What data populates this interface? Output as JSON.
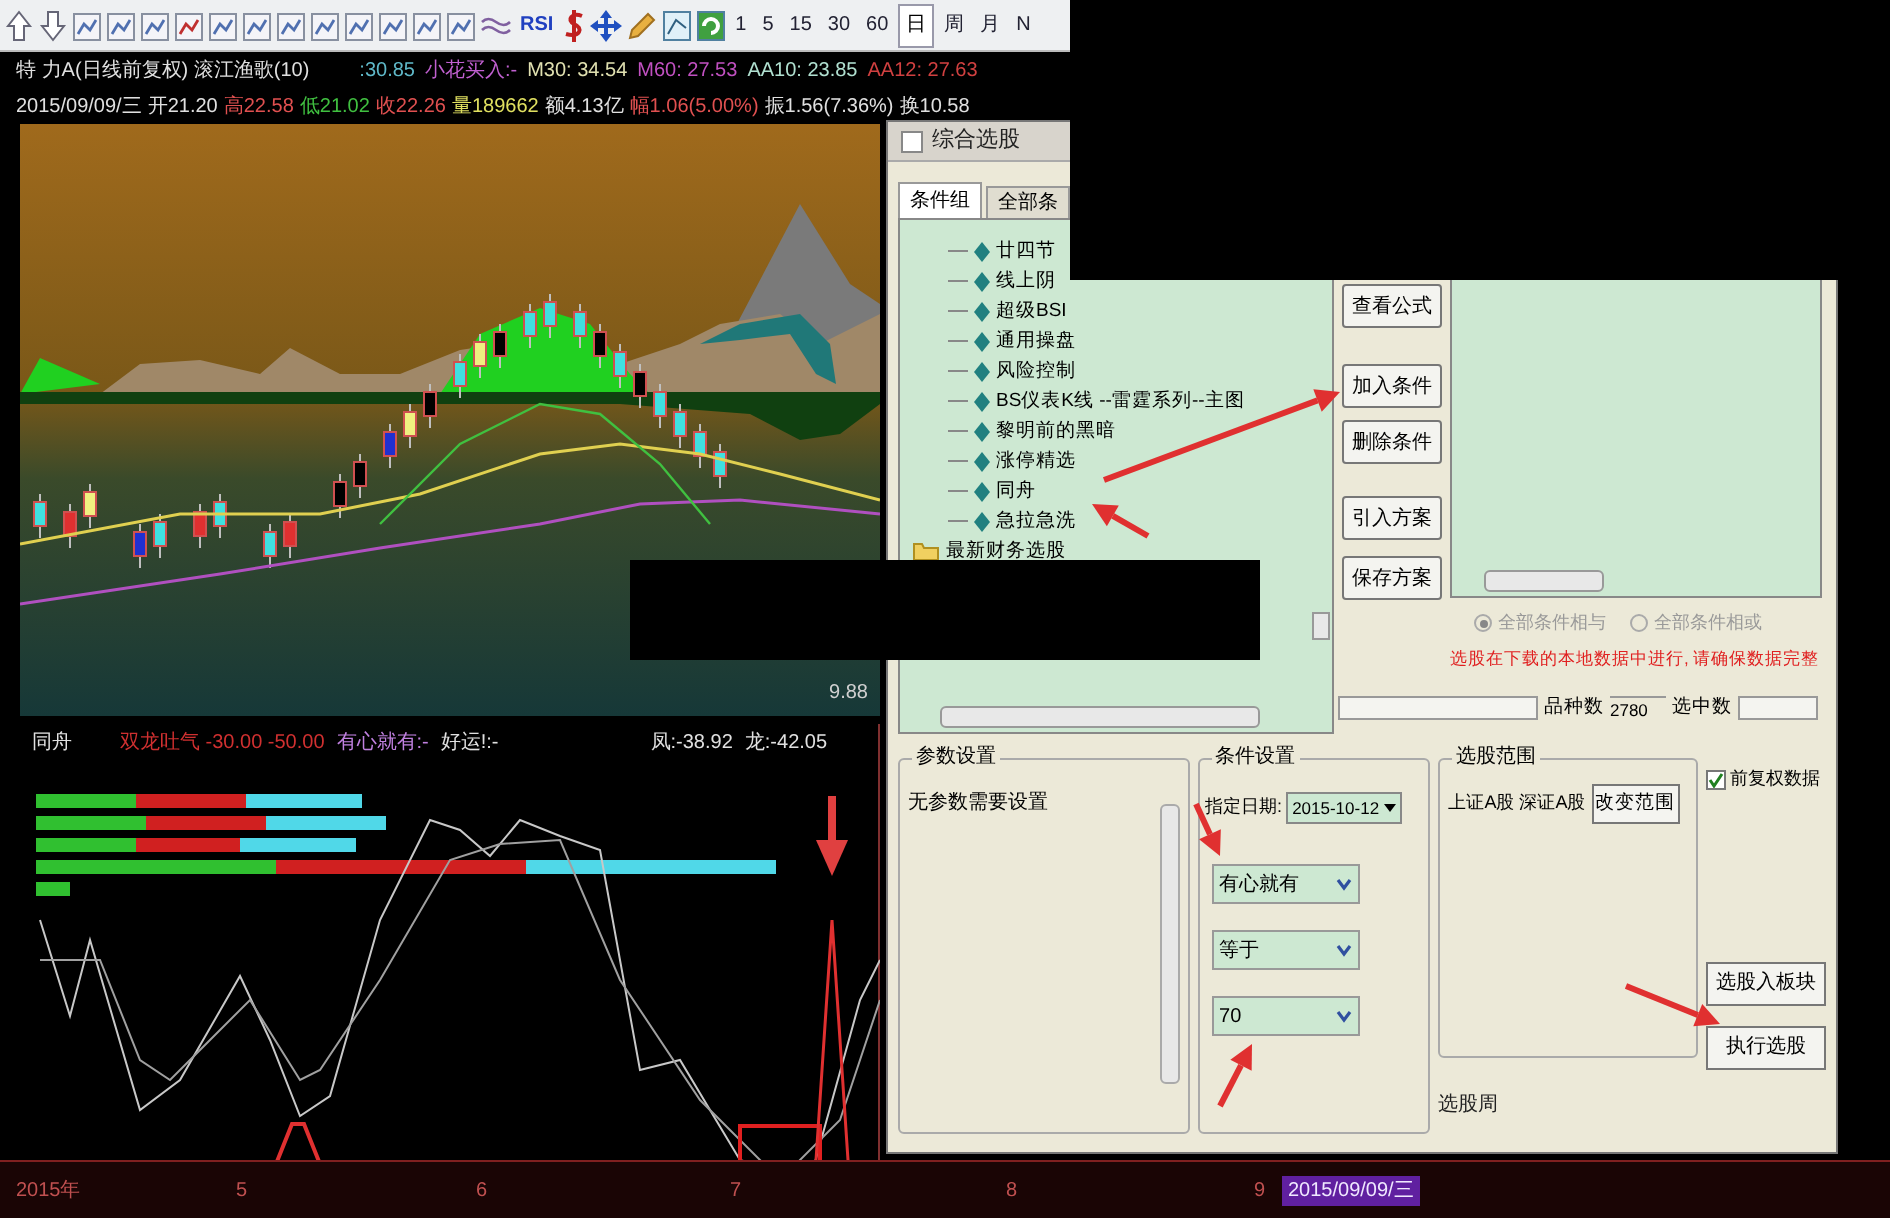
{
  "toolbar": {
    "periods": [
      {
        "label": "1",
        "selected": false
      },
      {
        "label": "5",
        "selected": false
      },
      {
        "label": "15",
        "selected": false
      },
      {
        "label": "30",
        "selected": false
      },
      {
        "label": "60",
        "selected": false
      },
      {
        "label": "日",
        "selected": true
      },
      {
        "label": "周",
        "selected": false
      },
      {
        "label": "月",
        "selected": false
      },
      {
        "label": "N",
        "selected": false
      }
    ],
    "rsi_label": "RSI"
  },
  "chart_header": {
    "title": "特 力A(日线前复权) 滚江渔歌(10)",
    "readings": [
      {
        "text": ":30.85",
        "color": "#5fb8c8"
      },
      {
        "text": "小花买入:-",
        "color": "#c060d0"
      },
      {
        "text": "M30: 34.54",
        "color": "#e0e0b0"
      },
      {
        "text": "M60: 27.53",
        "color": "#c050c0"
      },
      {
        "text": "AA10: 23.85",
        "color": "#b0e0d0"
      },
      {
        "text": "AA12: 27.63",
        "color": "#d04040"
      }
    ]
  },
  "quote_row": [
    {
      "text": "2015/09/09/三",
      "color": "#e0e0e0"
    },
    {
      "text": "开21.20",
      "color": "#e0e0e0"
    },
    {
      "text": "高22.58",
      "color": "#e05050"
    },
    {
      "text": "低21.02",
      "color": "#40c040"
    },
    {
      "text": "收22.26",
      "color": "#e05050"
    },
    {
      "text": "量189662",
      "color": "#e0e060"
    },
    {
      "text": "额4.13亿",
      "color": "#e0e0e0"
    },
    {
      "text": "幅1.06(5.00%)",
      "color": "#e05050"
    },
    {
      "text": "振1.56(7.36%)",
      "color": "#e0e0e0"
    },
    {
      "text": "换10.58",
      "color": "#e0e0e0"
    }
  ],
  "main_chart": {
    "price_label": "9.88"
  },
  "indicator_panel": {
    "title": "同舟",
    "readings": [
      {
        "text": "双龙吐气 -30.00 -50.00",
        "color": "#d03030"
      },
      {
        "text": "有心就有:-",
        "color": "#c080e0"
      },
      {
        "text": "好运!:-",
        "color": "#e0e0e0"
      },
      {
        "text": "凤:-38.92",
        "color": "#e0e0e0"
      },
      {
        "text": "龙:-42.05",
        "color": "#e0e0e0"
      }
    ]
  },
  "time_axis": {
    "labels": [
      "2015年",
      "5",
      "6",
      "7",
      "8",
      "9"
    ],
    "cursor_date": "2015/09/09/三"
  },
  "dialog": {
    "title": "综合选股",
    "tabs": [
      {
        "label": "条件组",
        "selected": true
      },
      {
        "label": "全部条",
        "selected": false
      }
    ],
    "tree": [
      {
        "label": "廿四节",
        "kind": "formula"
      },
      {
        "label": "线上阴",
        "kind": "formula"
      },
      {
        "label": "超级BSI",
        "kind": "formula"
      },
      {
        "label": "通用操盘",
        "kind": "formula"
      },
      {
        "label": "风险控制",
        "kind": "formula"
      },
      {
        "label": "BS仪表K线 --雷霆系列--主图",
        "kind": "formula"
      },
      {
        "label": "黎明前的黑暗",
        "kind": "formula"
      },
      {
        "label": "涨停精选",
        "kind": "formula"
      },
      {
        "label": "同舟",
        "kind": "formula"
      },
      {
        "label": "急拉急洗",
        "kind": "formula"
      },
      {
        "label": "最新财务选股",
        "kind": "folder"
      }
    ],
    "side_buttons": [
      "查看公式",
      "加入条件",
      "删除条件",
      "引入方案",
      "保存方案"
    ],
    "logic": [
      {
        "label": "全部条件相与",
        "selected": true
      },
      {
        "label": "全部条件相或",
        "selected": false
      }
    ],
    "notice": "选股在下载的本地数据中进行, 请确保数据完整",
    "count_label": "品种数",
    "count_value": "2780",
    "selected_label": "选中数",
    "params": {
      "title": "参数设置",
      "text": "无参数需要设置"
    },
    "conditions": {
      "title": "条件设置",
      "date_label": "指定日期:",
      "date": "2015-10-12",
      "selects": [
        "有心就有",
        "等于",
        "70"
      ]
    },
    "range": {
      "title": "选股范围",
      "text": "上证A股 深证A股",
      "button": "改变范围",
      "period_label": "选股周"
    },
    "adjusted": {
      "label": "前复权数据",
      "checked": true
    },
    "buttons": [
      "选股入板块",
      "执行选股"
    ]
  }
}
